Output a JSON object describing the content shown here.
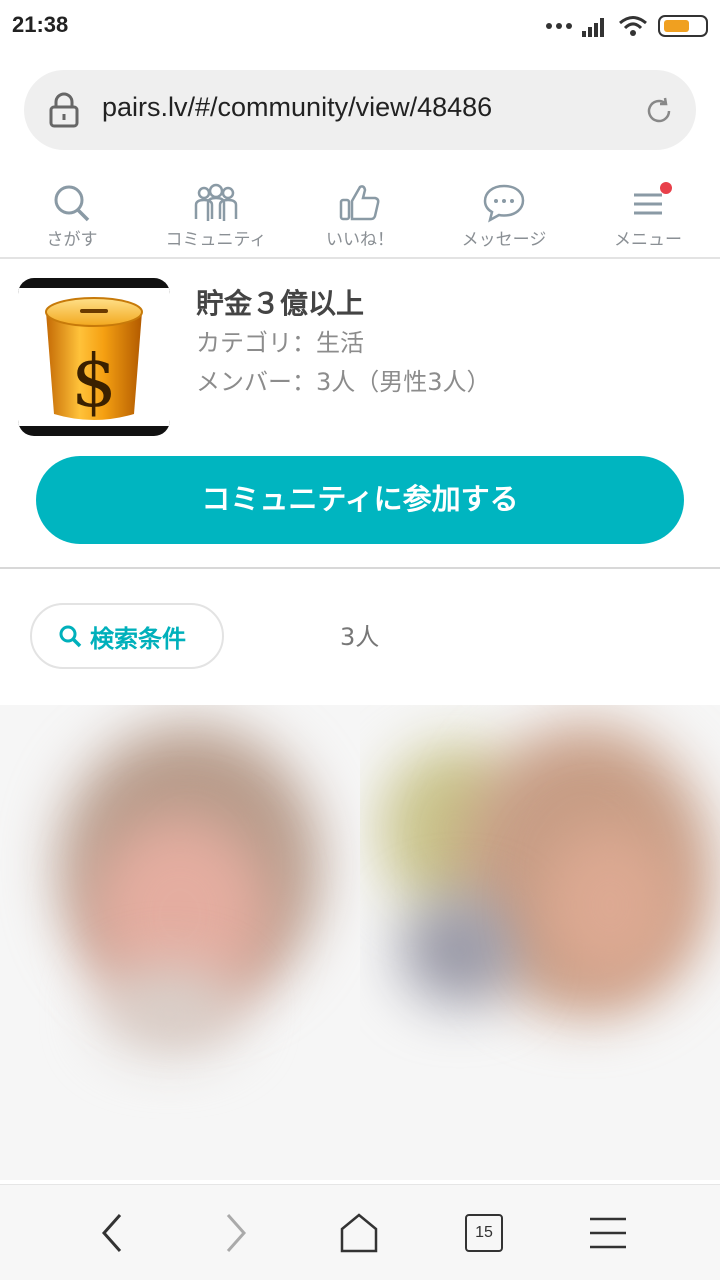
{
  "status_bar": {
    "time": "21:38",
    "battery_color": "#f0a020"
  },
  "address_bar": {
    "url": "pairs.lv/#/community/view/48486",
    "icons": [
      "lock-icon",
      "refresh-icon"
    ]
  },
  "top_nav": {
    "items": [
      {
        "label": "さがす",
        "icon": "search-icon"
      },
      {
        "label": "コミュニティ",
        "icon": "community-icon"
      },
      {
        "label": "いいね！",
        "icon": "thumbs-up-icon"
      },
      {
        "label": "メッセージ",
        "icon": "message-icon"
      },
      {
        "label": "メニュー",
        "icon": "menu-icon",
        "notification": true
      }
    ]
  },
  "community": {
    "title": "貯金３億以上",
    "category": "カテゴリ：生活",
    "members": "メンバー：3人（男性3人）",
    "thumbnail_icon": "money-jar-icon",
    "join_button": "コミュニティに参加する",
    "accent_color": "#00b5c0"
  },
  "filter": {
    "search_button": "検索条件",
    "count": "3人"
  },
  "bottom_bar": {
    "tab_count": "15",
    "icons": [
      "back-icon",
      "forward-icon",
      "home-icon",
      "tabs-icon",
      "menu-icon"
    ]
  }
}
